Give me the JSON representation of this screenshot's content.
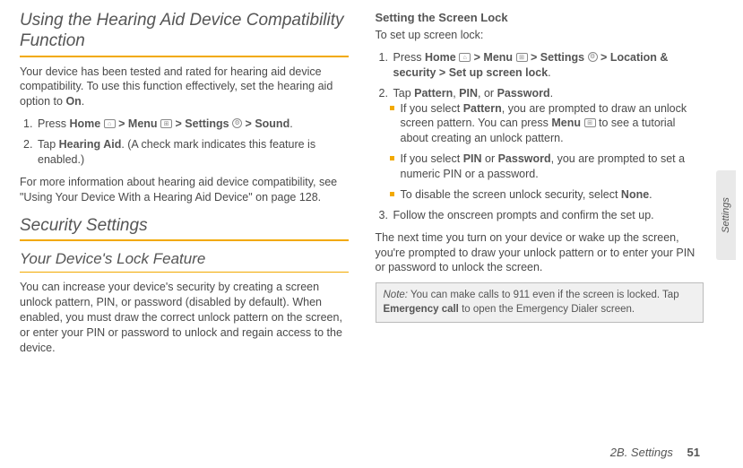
{
  "left": {
    "h2": "Using the Hearing Aid Device Compatibility Function",
    "p1a": "Your device has been tested and rated for hearing aid device compatibility. To use this function effectively, set the hearing aid option to ",
    "p1b": "On",
    "p1c": ".",
    "step1": {
      "num": "1.",
      "press": "Press ",
      "home": "Home",
      "gt1": " > ",
      "menu": "Menu",
      "gt2": " > ",
      "settings": "Settings",
      "gt3": " > ",
      "sound": "Sound",
      "dot": "."
    },
    "step2": {
      "num": "2.",
      "tap": "Tap ",
      "ha": "Hearing Aid",
      "rest": ". (A check mark indicates this feature is enabled.)"
    },
    "p2": "For more information about hearing aid device compatibility, see \"Using Your Device With a Hearing Aid Device\" on page 128.",
    "h2b": "Security Settings",
    "h3": "Your Device's Lock Feature",
    "p3": "You can increase your device's security by creating a screen unlock pattern, PIN, or password (disabled by default). When enabled, you must draw the correct unlock pattern on the screen, or enter your PIN or password to unlock and regain access to the device."
  },
  "right": {
    "h4": "Setting the Screen Lock",
    "intro": "To set up screen lock:",
    "step1": {
      "num": "1.",
      "press": "Press ",
      "home": "Home",
      "gt1": " > ",
      "menu": "Menu",
      "gt2": " > ",
      "settings": "Settings",
      "gt3": " > ",
      "loc": "Location & security",
      "gt4": " > ",
      "setup": "Set up screen lock",
      "dot": "."
    },
    "step2": {
      "num": "2.",
      "tap": "Tap ",
      "pattern": "Pattern",
      "c1": ", ",
      "pin": "PIN",
      "c2": ", or ",
      "pwd": "Password",
      "dot": "."
    },
    "b1a": "If you select ",
    "b1b": "Pattern",
    "b1c": ", you are prompted to draw an unlock screen pattern. You can press ",
    "b1d": "Menu",
    "b1e": " to see a tutorial about creating an unlock pattern.",
    "b2a": "If you select ",
    "b2b": "PIN",
    "b2c": " or ",
    "b2d": "Password",
    "b2e": ", you are prompted to set a numeric PIN or a password.",
    "b3a": "To disable the screen unlock security, select ",
    "b3b": "None",
    "b3c": ".",
    "step3": {
      "num": "3.",
      "text": "Follow the onscreen prompts and confirm the set up."
    },
    "p4": "The next time you turn on your device or wake up the screen, you're prompted to draw your unlock pattern or to enter your PIN or password to unlock the screen.",
    "note_label": "Note:",
    "note_a": " You can make calls to 911 even if the screen is locked. Tap ",
    "note_b": "Emergency call",
    "note_c": " to open the Emergency Dialer screen."
  },
  "footer": {
    "chapter": "2B. Settings",
    "page": "51"
  },
  "sidetab": "Settings",
  "icons": {
    "home": "⌂",
    "menu": "⊞",
    "settings": "⚙"
  }
}
